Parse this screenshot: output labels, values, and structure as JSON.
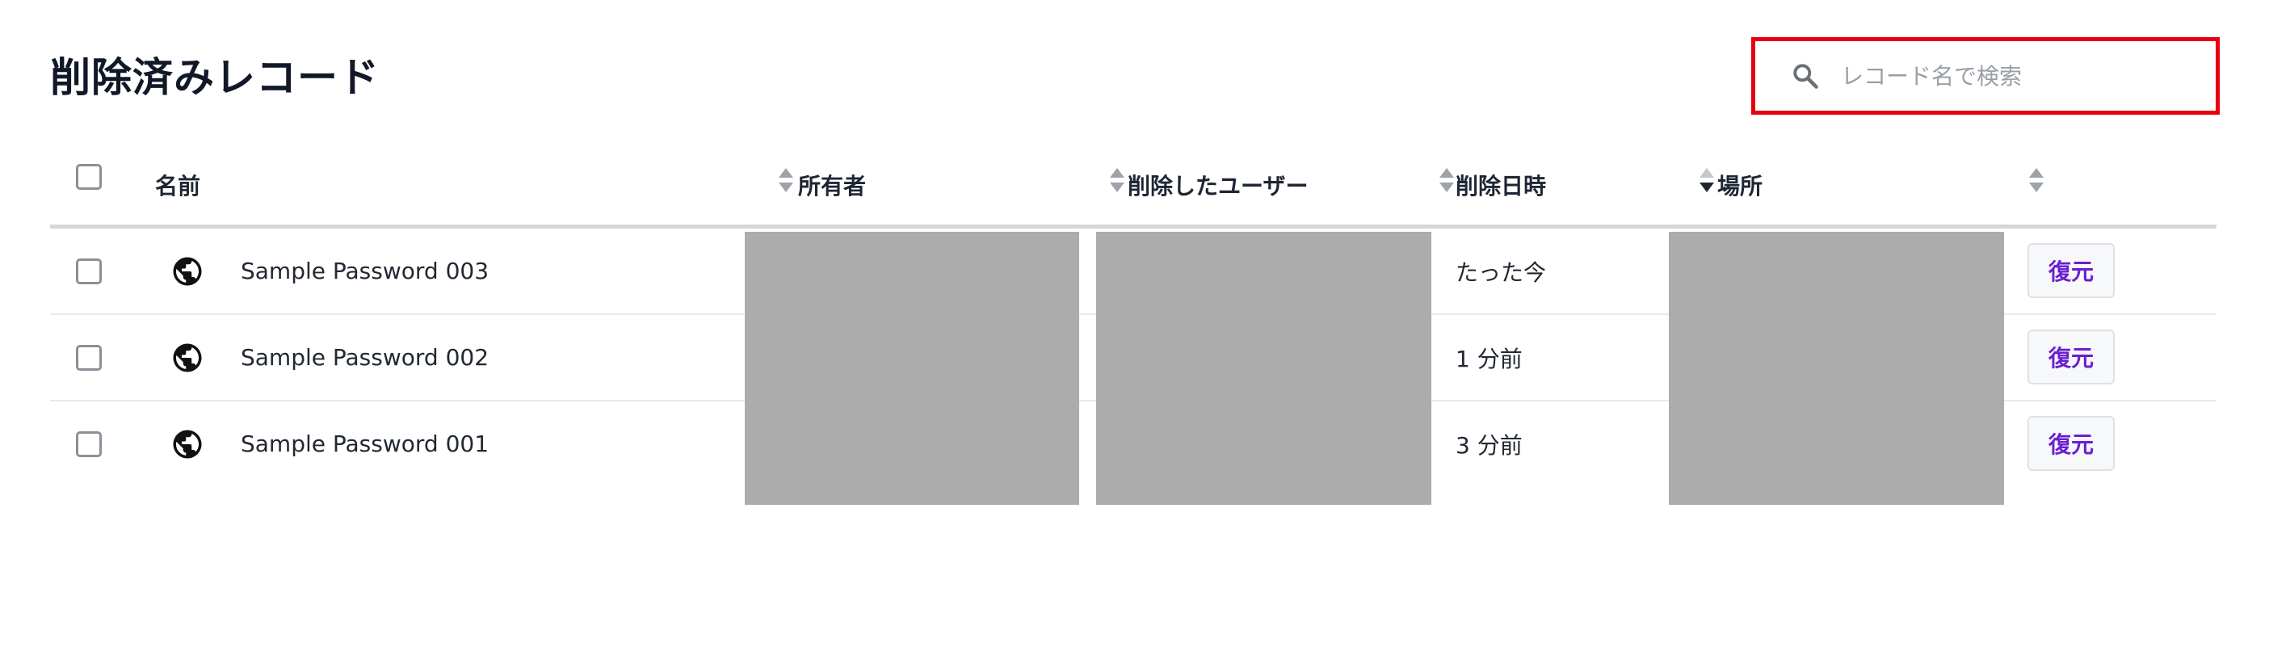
{
  "page": {
    "title": "削除済みレコード"
  },
  "search": {
    "placeholder": "レコード名で検索",
    "icon": "search-icon"
  },
  "table": {
    "columns": {
      "name": "名前",
      "owner": "所有者",
      "deleted_by": "削除したユーザー",
      "deleted_at": "削除日時",
      "location": "場所"
    },
    "sort": {
      "active_column": "deleted_at",
      "direction": "descending"
    },
    "rows": [
      {
        "name": "Sample Password 003",
        "deleted_at": "たった今",
        "restore_label": "復元",
        "icon": "globe-icon"
      },
      {
        "name": "Sample Password 002",
        "deleted_at": "1 分前",
        "restore_label": "復元",
        "icon": "globe-icon"
      },
      {
        "name": "Sample Password 001",
        "deleted_at": "3 分前",
        "restore_label": "復元",
        "icon": "globe-icon"
      }
    ]
  },
  "colors": {
    "accent": "#6a1fd1",
    "highlight_border": "#e5000f",
    "redaction": "#acacac"
  }
}
